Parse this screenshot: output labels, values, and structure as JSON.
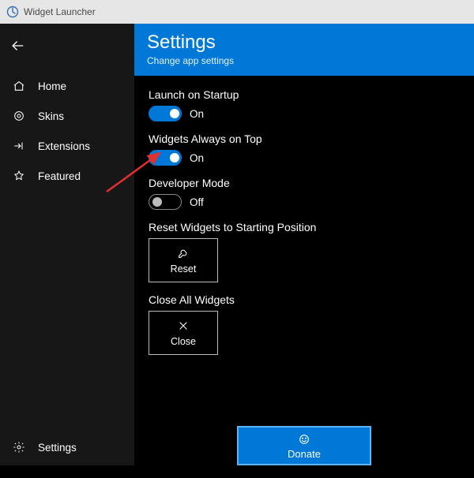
{
  "titlebar": {
    "title": "Widget Launcher"
  },
  "sidebar": {
    "items": [
      {
        "icon": "home-icon",
        "label": "Home"
      },
      {
        "icon": "skins-icon",
        "label": "Skins"
      },
      {
        "icon": "extensions-icon",
        "label": "Extensions"
      },
      {
        "icon": "featured-icon",
        "label": "Featured"
      }
    ],
    "bottom": {
      "icon": "settings-icon",
      "label": "Settings"
    }
  },
  "header": {
    "title": "Settings",
    "subtitle": "Change app settings"
  },
  "settings": {
    "launch_on_startup": {
      "label": "Launch on Startup",
      "state": "On",
      "on": true
    },
    "always_on_top": {
      "label": "Widgets Always on Top",
      "state": "On",
      "on": true
    },
    "developer_mode": {
      "label": "Developer Mode",
      "state": "Off",
      "on": false
    },
    "reset": {
      "label": "Reset Widgets to Starting Position",
      "button": "Reset"
    },
    "close": {
      "label": "Close All Widgets",
      "button": "Close"
    }
  },
  "donate": {
    "label": "Donate"
  },
  "colors": {
    "accent": "#0078d7"
  }
}
